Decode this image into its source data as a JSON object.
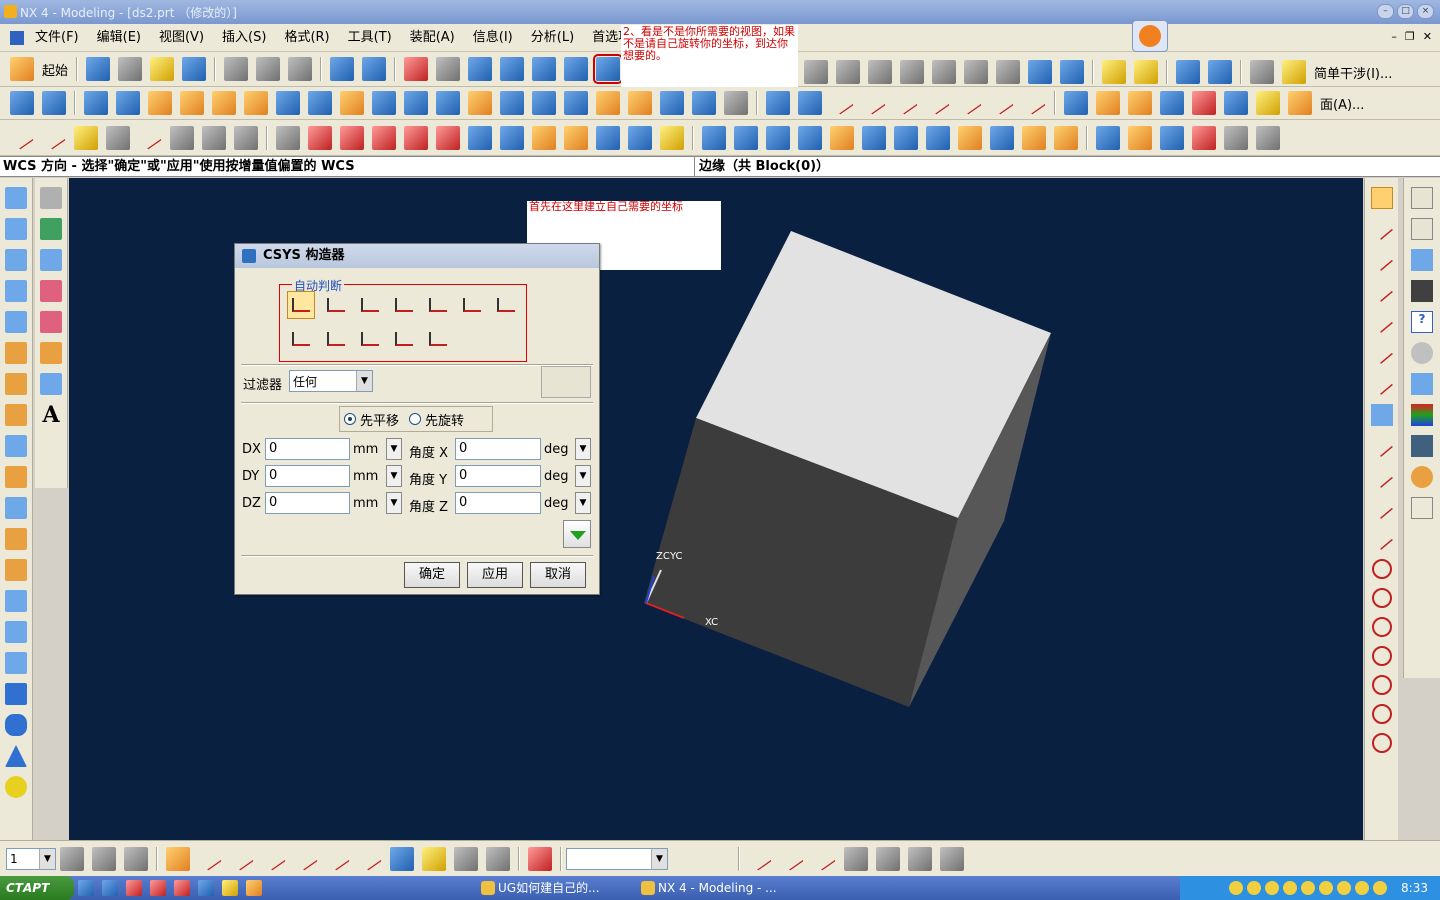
{
  "window": {
    "title": "NX 4 - Modeling - [ds2.prt （修改的）]"
  },
  "menu": [
    "文件(F)",
    "编辑(E)",
    "视图(V)",
    "插入(S)",
    "格式(R)",
    "工具(T)",
    "装配(A)",
    "信息(I)",
    "分析(L)",
    "首选项(P)"
  ],
  "toolbar": {
    "start_label": "起始",
    "simple_interference_label": "简单干涉(I)...",
    "face_label": "面(A)..."
  },
  "annotation_top": "2、看是不是你所需要的视图，如果不是请自己旋转你的坐标，到达你想要的。",
  "annotation_canvas": "首先在这里建立自己需要的坐标",
  "status": {
    "prompt": "WCS 方向 - 选择\"确定\"或\"应用\"使用按增量值偏置的 WCS",
    "selection": "边缘（共 Block(0)）"
  },
  "dialog": {
    "title": "CSYS 构造器",
    "group_label": "自动判断",
    "filter_label": "过滤器",
    "filter_value": "任何",
    "radio_translate": "先平移",
    "radio_rotate": "先旋转",
    "rows": [
      {
        "label": "DX",
        "value": "0",
        "unit": "mm",
        "angle_label": "角度 X",
        "angle_value": "0",
        "angle_unit": "deg"
      },
      {
        "label": "DY",
        "value": "0",
        "unit": "mm",
        "angle_label": "角度 Y",
        "angle_value": "0",
        "angle_unit": "deg"
      },
      {
        "label": "DZ",
        "value": "0",
        "unit": "mm",
        "angle_label": "角度 Z",
        "angle_value": "0",
        "angle_unit": "deg"
      }
    ],
    "ok_label": "确定",
    "apply_label": "应用",
    "cancel_label": "取消"
  },
  "viewport": {
    "axis_z_label": "ZC",
    "axis_y_label": "YC",
    "axis_x_label": "XC",
    "background": "#0a2040",
    "cube_top_color": "#e2e2e2",
    "cube_front_color": "#3c3c3c",
    "cube_side_color": "#575757"
  },
  "bottom_toolbar": {
    "layer_value": "1"
  },
  "taskbar": {
    "start": "СТАРТ",
    "items": [
      "UG如何建自己的...",
      "NX 4 - Modeling - ..."
    ],
    "clock": "8:33"
  }
}
